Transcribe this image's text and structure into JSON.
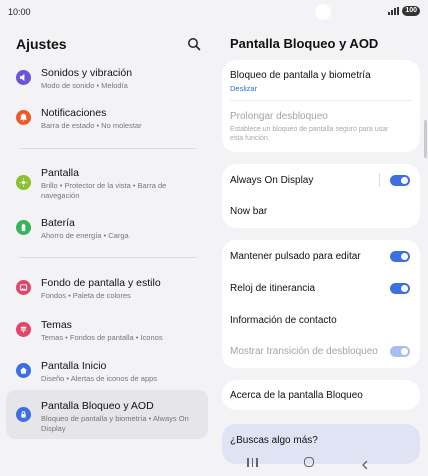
{
  "status_bar": {
    "time": "10:00",
    "battery": "100"
  },
  "left": {
    "title": "Ajustes",
    "items": [
      {
        "title": "Sonidos y vibración",
        "subtitle": "Modo de sonido • Melodía",
        "color": "#6a55d8"
      },
      {
        "title": "Notificaciones",
        "subtitle": "Barra de estado • No molestar",
        "color": "#ea5a2a"
      },
      {
        "title": "Pantalla",
        "subtitle": "Brillo • Protector de la vista • Barra de navegación",
        "color": "#8bc12a"
      },
      {
        "title": "Batería",
        "subtitle": "Ahorro de energía • Carga",
        "color": "#37b45a"
      },
      {
        "title": "Fondo de pantalla y estilo",
        "subtitle": "Fondos • Paleta de colores",
        "color": "#e2456a"
      },
      {
        "title": "Temas",
        "subtitle": "Temas • Fondos de pantalla • Iconos",
        "color": "#e2456a"
      },
      {
        "title": "Pantalla Inicio",
        "subtitle": "Diseño • Alertas de iconos de apps",
        "color": "#3c6fe0"
      },
      {
        "title": "Pantalla Bloqueo y AOD",
        "subtitle": "Bloqueo de pantalla y biometría • Always On Display",
        "color": "#3c6fe0"
      }
    ]
  },
  "right": {
    "title": "Pantalla Bloqueo y AOD",
    "lock_biometrics": {
      "title": "Bloqueo de pantalla y biometría",
      "value": "Deslizar"
    },
    "extend_unlock": {
      "title": "Prolongar desbloqueo",
      "description": "Establece un bloqueo de pantalla seguro para usar esta función."
    },
    "aod": {
      "title": "Always On Display",
      "on": true
    },
    "now_bar": {
      "title": "Now bar"
    },
    "press_edit": {
      "title": "Mantener pulsado para editar",
      "on": true
    },
    "roaming_clock": {
      "title": "Reloj de itinerancia",
      "on": true
    },
    "contact_info": {
      "title": "Información de contacto"
    },
    "unlock_transition": {
      "title": "Mostrar transición de desbloqueo",
      "on": true
    },
    "about": {
      "title": "Acerca de la pantalla Bloqueo"
    },
    "looking_more": "¿Buscas algo más?"
  }
}
